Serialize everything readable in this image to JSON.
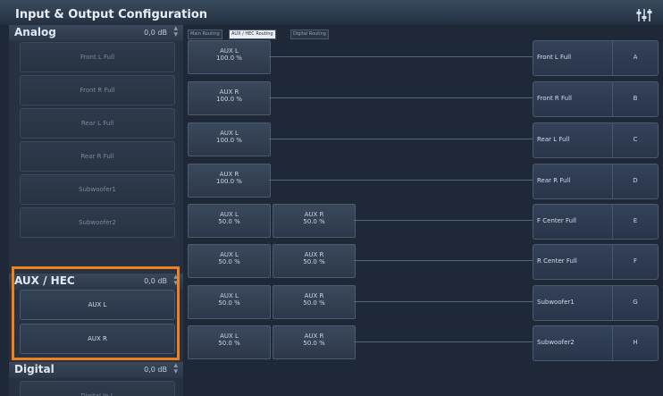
{
  "header": {
    "title": "Input & Output Configuration",
    "icon": "mixer-icon"
  },
  "sections": {
    "analog": {
      "title": "Analog",
      "db": "0,0 dB",
      "items": [
        "Front L Full",
        "Front R Full",
        "Rear L Full",
        "Rear R Full",
        "Subwoofer1",
        "Subwoofer2"
      ]
    },
    "aux": {
      "title": "AUX / HEC",
      "db": "0,0 dB",
      "items": [
        "AUX L",
        "AUX R"
      ]
    },
    "digital": {
      "title": "Digital",
      "db": "0,0 dB",
      "items": [
        "Digital In L"
      ]
    }
  },
  "tabs": [
    {
      "label": "Main Routing",
      "active": false
    },
    {
      "label": "AUX / HEC Routing",
      "active": true
    },
    {
      "label": "Digital Routing",
      "active": false
    }
  ],
  "routes": [
    {
      "sources": [
        {
          "name": "AUX L",
          "level": "100.0 %"
        }
      ],
      "dest": "Front L Full",
      "letter": "A"
    },
    {
      "sources": [
        {
          "name": "AUX R",
          "level": "100.0 %"
        }
      ],
      "dest": "Front R Full",
      "letter": "B"
    },
    {
      "sources": [
        {
          "name": "AUX L",
          "level": "100.0 %"
        }
      ],
      "dest": "Rear L Full",
      "letter": "C"
    },
    {
      "sources": [
        {
          "name": "AUX R",
          "level": "100.0 %"
        }
      ],
      "dest": "Rear R Full",
      "letter": "D"
    },
    {
      "sources": [
        {
          "name": "AUX L",
          "level": "50.0 %"
        },
        {
          "name": "AUX R",
          "level": "50.0 %"
        }
      ],
      "dest": "F Center Full",
      "letter": "E"
    },
    {
      "sources": [
        {
          "name": "AUX L",
          "level": "50.0 %"
        },
        {
          "name": "AUX R",
          "level": "50.0 %"
        }
      ],
      "dest": "R Center Full",
      "letter": "F"
    },
    {
      "sources": [
        {
          "name": "AUX L",
          "level": "50.0 %"
        },
        {
          "name": "AUX R",
          "level": "50.0 %"
        }
      ],
      "dest": "Subwoofer1",
      "letter": "G"
    },
    {
      "sources": [
        {
          "name": "AUX L",
          "level": "50.0 %"
        },
        {
          "name": "AUX R",
          "level": "50.0 %"
        }
      ],
      "dest": "Subwoofer2",
      "letter": "H"
    }
  ],
  "colors": {
    "highlight": "#f07f1e",
    "background": "#1e2836"
  }
}
